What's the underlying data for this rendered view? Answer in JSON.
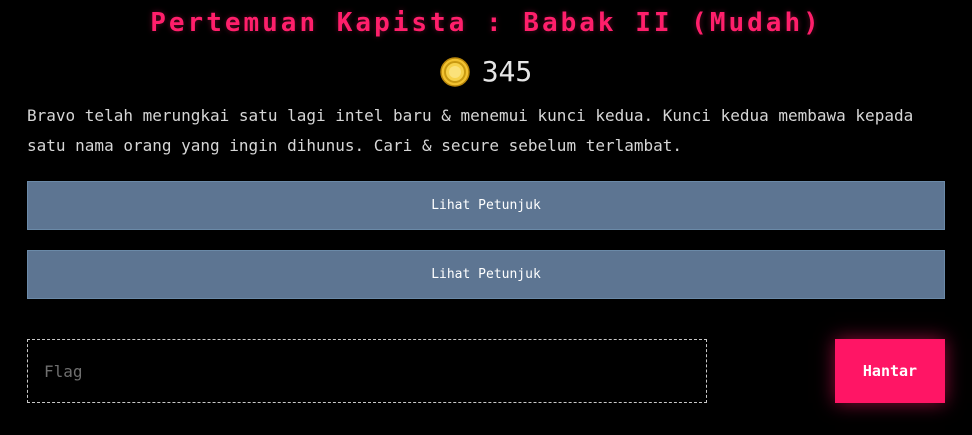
{
  "header": {
    "title": "Pertemuan Kapista : Babak II (Mudah)"
  },
  "coins": {
    "icon": "coin-icon",
    "count": "345",
    "color": "#f2c230"
  },
  "description": "Bravo telah merungkai satu lagi intel baru & menemui kunci kedua. Kunci kedua membawa kepada satu nama orang yang ingin dihunus. Cari & secure sebelum terlambat.",
  "hints": [
    {
      "label": "Lihat Petunjuk"
    },
    {
      "label": "Lihat Petunjuk"
    }
  ],
  "flag_form": {
    "input_value": "",
    "placeholder": "Flag",
    "submit_label": "Hantar"
  },
  "colors": {
    "accent": "#ff1565",
    "hint_button": "#5d7592",
    "background": "#000000"
  }
}
